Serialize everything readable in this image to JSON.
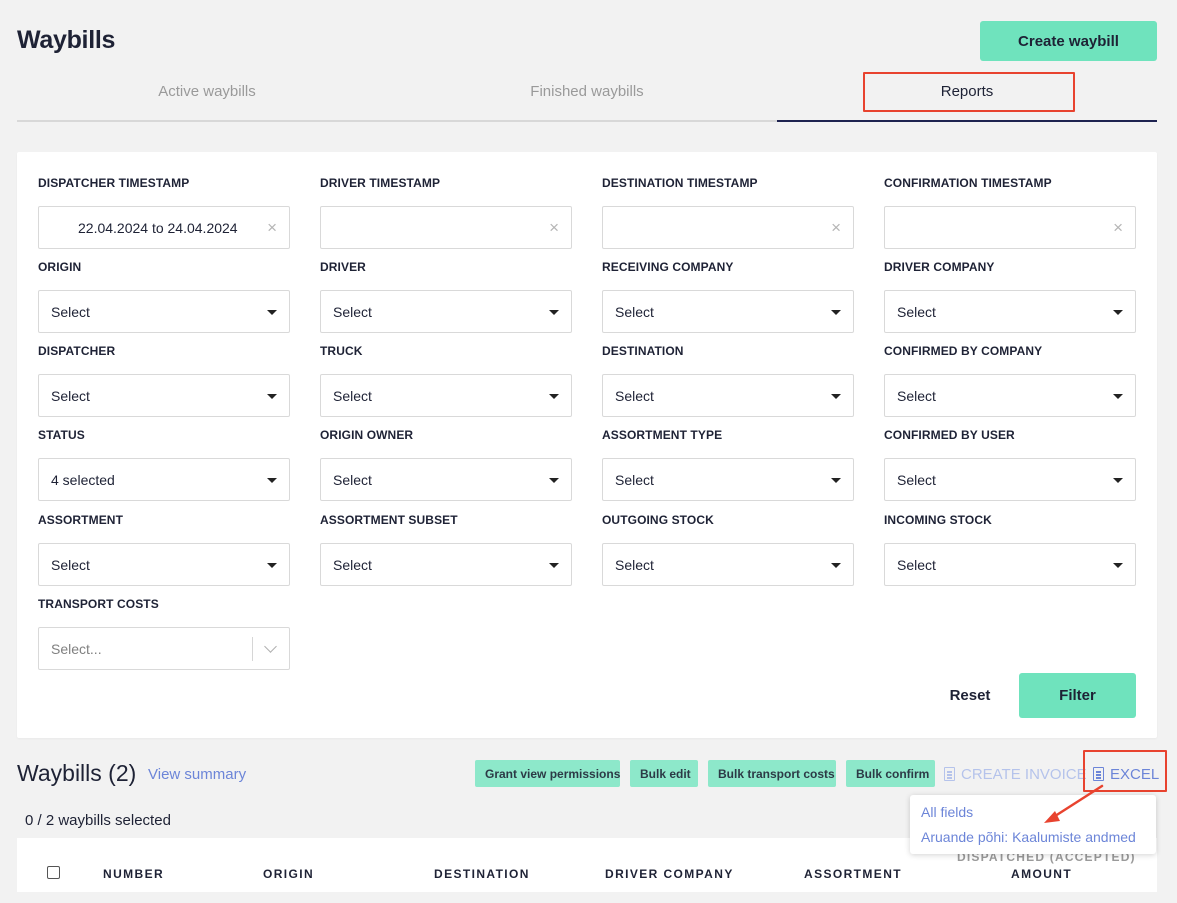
{
  "page": {
    "title": "Waybills",
    "create_button": "Create waybill"
  },
  "tabs": [
    {
      "label": "Active waybills",
      "active": false
    },
    {
      "label": "Finished waybills",
      "active": false
    },
    {
      "label": "Reports",
      "active": true
    }
  ],
  "filters": {
    "dispatcher_timestamp": {
      "label": "DISPATCHER TIMESTAMP",
      "value": "22.04.2024 to 24.04.2024"
    },
    "driver_timestamp": {
      "label": "DRIVER TIMESTAMP",
      "value": ""
    },
    "destination_timestamp": {
      "label": "DESTINATION TIMESTAMP",
      "value": ""
    },
    "confirmation_timestamp": {
      "label": "CONFIRMATION TIMESTAMP",
      "value": ""
    },
    "origin": {
      "label": "ORIGIN",
      "value": "Select"
    },
    "driver": {
      "label": "DRIVER",
      "value": "Select"
    },
    "receiving_company": {
      "label": "RECEIVING COMPANY",
      "value": "Select"
    },
    "driver_company": {
      "label": "DRIVER COMPANY",
      "value": "Select"
    },
    "dispatcher": {
      "label": "DISPATCHER",
      "value": "Select"
    },
    "truck": {
      "label": "TRUCK",
      "value": "Select"
    },
    "destination": {
      "label": "DESTINATION",
      "value": "Select"
    },
    "confirmed_by_company": {
      "label": "CONFIRMED BY COMPANY",
      "value": "Select"
    },
    "status": {
      "label": "STATUS",
      "value": "4 selected"
    },
    "origin_owner": {
      "label": "ORIGIN OWNER",
      "value": "Select"
    },
    "assortment_type": {
      "label": "ASSORTMENT TYPE",
      "value": "Select"
    },
    "confirmed_by_user": {
      "label": "CONFIRMED BY USER",
      "value": "Select"
    },
    "assortment": {
      "label": "ASSORTMENT",
      "value": "Select"
    },
    "assortment_subset": {
      "label": "ASSORTMENT SUBSET",
      "value": "Select"
    },
    "outgoing_stock": {
      "label": "OUTGOING STOCK",
      "value": "Select"
    },
    "incoming_stock": {
      "label": "INCOMING STOCK",
      "value": "Select"
    },
    "transport_costs": {
      "label": "TRANSPORT COSTS",
      "placeholder": "Select..."
    },
    "reset_label": "Reset",
    "filter_label": "Filter"
  },
  "list": {
    "title": "Waybills (2)",
    "view_summary": "View summary",
    "actions": {
      "grant": "Grant view permissions",
      "bulk_edit": "Bulk edit",
      "bulk_transport": "Bulk transport costs",
      "bulk_confirm": "Bulk confirm",
      "create_invoice": "CREATE INVOICE",
      "excel": "EXCEL"
    },
    "selected_count": "0 / 2 waybills selected",
    "columns": {
      "number": "NUMBER",
      "origin": "ORIGIN",
      "destination": "DESTINATION",
      "driver_company": "DRIVER COMPANY",
      "assortment": "ASSORTMENT",
      "dispatched": "DISPATCHED (ACCEPTED)",
      "amount": "AMOUNT"
    }
  },
  "excel_menu": {
    "items": [
      "All fields",
      "Aruande põhi: Kaalumiste andmed"
    ]
  },
  "colors": {
    "accent": "#6fe3bd",
    "link": "#6c85d8",
    "annotation": "#e8432f",
    "active_tab_underline": "#1e2350"
  }
}
